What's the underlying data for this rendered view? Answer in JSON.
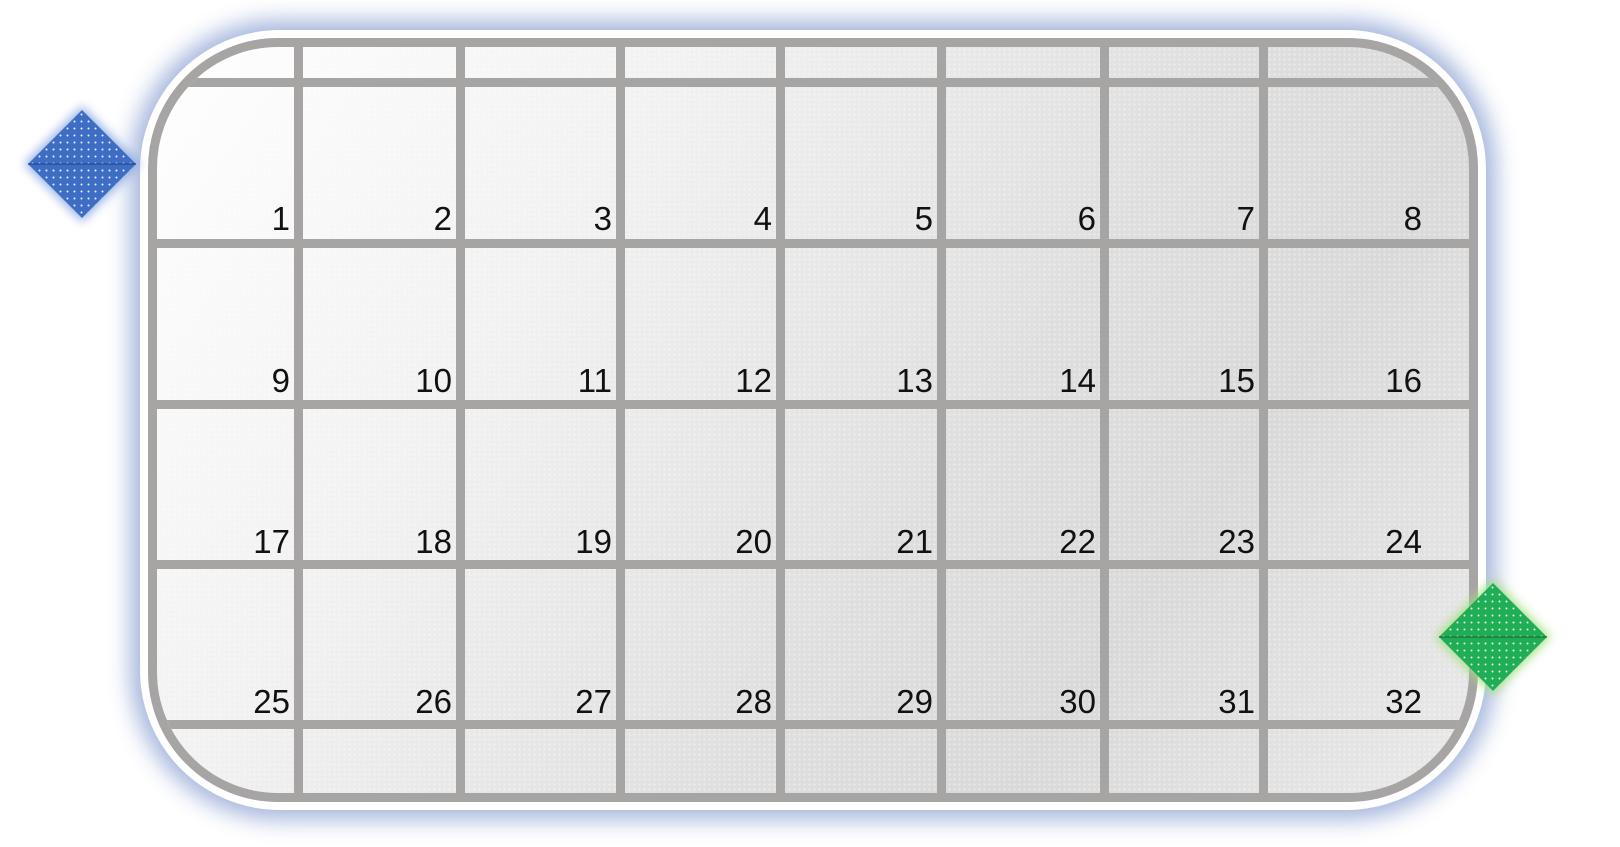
{
  "grid": {
    "rows": 4,
    "columns": 8,
    "cells": [
      "1",
      "2",
      "3",
      "4",
      "5",
      "6",
      "7",
      "8",
      "9",
      "10",
      "11",
      "12",
      "13",
      "14",
      "15",
      "16",
      "17",
      "18",
      "19",
      "20",
      "21",
      "22",
      "23",
      "24",
      "25",
      "26",
      "27",
      "28",
      "29",
      "30",
      "31",
      "32"
    ]
  },
  "colors": {
    "tray_border": "#a7a4a4",
    "tray_glow": "#96aad7",
    "marker_blue": "#3e6ec4",
    "marker_green": "#1fae56"
  },
  "markers": [
    {
      "name": "blue-diamond-marker-icon",
      "color": "#3e6ec4"
    },
    {
      "name": "green-diamond-marker-icon",
      "color": "#1fae56"
    }
  ]
}
